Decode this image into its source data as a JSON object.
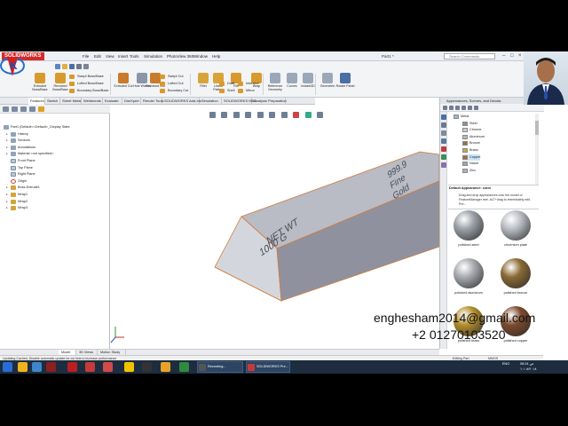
{
  "app": {
    "brand": "SOLIDWORKS",
    "menu": [
      "File",
      "Edit",
      "View",
      "Insert",
      "Tools",
      "Simulation",
      "PhotoView 360",
      "Window",
      "Help"
    ],
    "document_title": "Part1 *",
    "search_placeholder": "Search Commands",
    "window_controls": [
      "–",
      "□",
      "×"
    ]
  },
  "command_manager": {
    "large_buttons": [
      "Extruded Boss/Base",
      "Revolved Boss/Base",
      "Extruded Cut",
      "Hole Wizard",
      "Revolved Cut",
      "Fillet",
      "Linear Pattern",
      "Rib",
      "Wrap",
      "Reference Geometry",
      "Curves",
      "Instant3D",
      "Geometric",
      "Rotate Panel"
    ],
    "small_buttons": [
      "Swept Boss/Base",
      "Lofted Boss/Base",
      "Boundary Boss/Base",
      "Swept Cut",
      "Lofted Cut",
      "Boundary Cut",
      "Draft",
      "Shell",
      "Intersect",
      "Mirror"
    ]
  },
  "tabs": [
    "Features",
    "Sketch",
    "Sheet Metal",
    "Weldments",
    "Evaluate",
    "DimXpert",
    "Render Tools",
    "SOLIDWORKS Add-Ins",
    "Simulation",
    "SOLIDWORKS MBD",
    "Analysis Preparation"
  ],
  "active_tab": "Features",
  "feature_tree": [
    {
      "label": "Part1 (Default<<Default>_Display State",
      "kind": "root",
      "indent": 0
    },
    {
      "label": "History",
      "kind": "folder",
      "indent": 1
    },
    {
      "label": "Sensors",
      "kind": "folder",
      "indent": 1
    },
    {
      "label": "Annotations",
      "kind": "folder",
      "indent": 1
    },
    {
      "label": "Material <not specified>",
      "kind": "folder",
      "indent": 1
    },
    {
      "label": "Front Plane",
      "kind": "plane",
      "indent": 1
    },
    {
      "label": "Top Plane",
      "kind": "plane",
      "indent": 1
    },
    {
      "label": "Right Plane",
      "kind": "plane",
      "indent": 1
    },
    {
      "label": "Origin",
      "kind": "origin",
      "indent": 1
    },
    {
      "label": "Boss-Extrude1",
      "kind": "feature",
      "indent": 1
    },
    {
      "label": "Wrap1",
      "kind": "feature",
      "indent": 1
    },
    {
      "label": "Wrap2",
      "kind": "feature",
      "indent": 1
    },
    {
      "label": "Wrap3",
      "kind": "feature",
      "indent": 1
    }
  ],
  "model": {
    "engraving_end": [
      "NET WT",
      "1000 G"
    ],
    "engraving_top": [
      "999.9",
      "Fine",
      "Gold"
    ],
    "color_body": "#a9abb6",
    "color_edge": "#d27a3a"
  },
  "task_pane": {
    "title": "Appearances, Scenes, and Decals",
    "tree": [
      {
        "label": "Metal",
        "swatch": "#9fb7cf",
        "selected": false,
        "indent": 0
      },
      {
        "label": "Steel",
        "swatch": "#8d9199",
        "selected": false,
        "indent": 1
      },
      {
        "label": "Chrome",
        "swatch": "#c9ccd2",
        "selected": false,
        "indent": 1
      },
      {
        "label": "Aluminum",
        "swatch": "#b6b8bd",
        "selected": false,
        "indent": 1
      },
      {
        "label": "Bronze",
        "swatch": "#9b6f3d",
        "selected": false,
        "indent": 1
      },
      {
        "label": "Brass",
        "swatch": "#c7a74a",
        "selected": false,
        "indent": 1
      },
      {
        "label": "Copper",
        "swatch": "#b5642f",
        "selected": true,
        "indent": 1
      },
      {
        "label": "Nickel",
        "swatch": "#a7a49a",
        "selected": false,
        "indent": 1
      },
      {
        "label": "Zinc",
        "swatch": "#aeb3b8",
        "selected": false,
        "indent": 1
      }
    ],
    "info_title": "Default Appearance: color",
    "info_text": "Drag and drop appearances onto the model or FeatureManager tree. ALT+drag to immediately edit. Pre...",
    "swatches": [
      {
        "label": "polished steel",
        "color": "#9aa0a6"
      },
      {
        "label": "chromium plate",
        "color": "#b9bdc3"
      },
      {
        "label": "polished aluminum",
        "color": "#a7abb0"
      },
      {
        "label": "polished bronze",
        "color": "#8a6a34"
      },
      {
        "label": "polished brass",
        "color": "#b38d2c"
      },
      {
        "label": "polished copper",
        "color": "#7b4a2c"
      }
    ]
  },
  "view_tabs": [
    "Model",
    "3D Views",
    "Motion Study 1"
  ],
  "status": {
    "left": "Updating Cached, Disable automatic update for cut lists to increase performance",
    "right_mode": "Editing Part",
    "units": "MMGS"
  },
  "taskbar": {
    "buttons": [
      "Recording...",
      "SOLIDWORKS Pre..."
    ],
    "tray_lang": "ENG",
    "tray_time": "08:24 ص",
    "tray_date": "۱۰/۰۸/۲۰۱۸"
  },
  "watermark": {
    "email": "enghesham2014@gmail.com",
    "phone": "+2 01270103520"
  }
}
